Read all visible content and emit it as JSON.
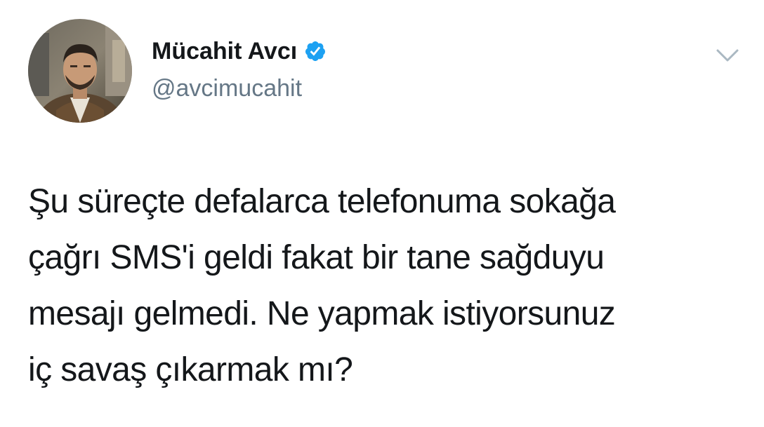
{
  "author": {
    "display_name": "Mücahit Avcı",
    "handle": "@avcimucahit",
    "verified": true
  },
  "icons": {
    "avatar": "profile-photo",
    "verified": "verified-badge-icon",
    "menu": "chevron-down-icon"
  },
  "colors": {
    "text": "#14171a",
    "handle": "#657786",
    "verified_badge": "#1da1f2",
    "chevron": "#aab8c2"
  },
  "tweet": {
    "lines": [
      "Şu süreçte defalarca telefonuma sokağa",
      "çağrı SMS'i geldi fakat bir tane sağduyu",
      "mesajı gelmedi. Ne yapmak istiyorsunuz",
      "iç savaş çıkarmak mı?"
    ]
  }
}
